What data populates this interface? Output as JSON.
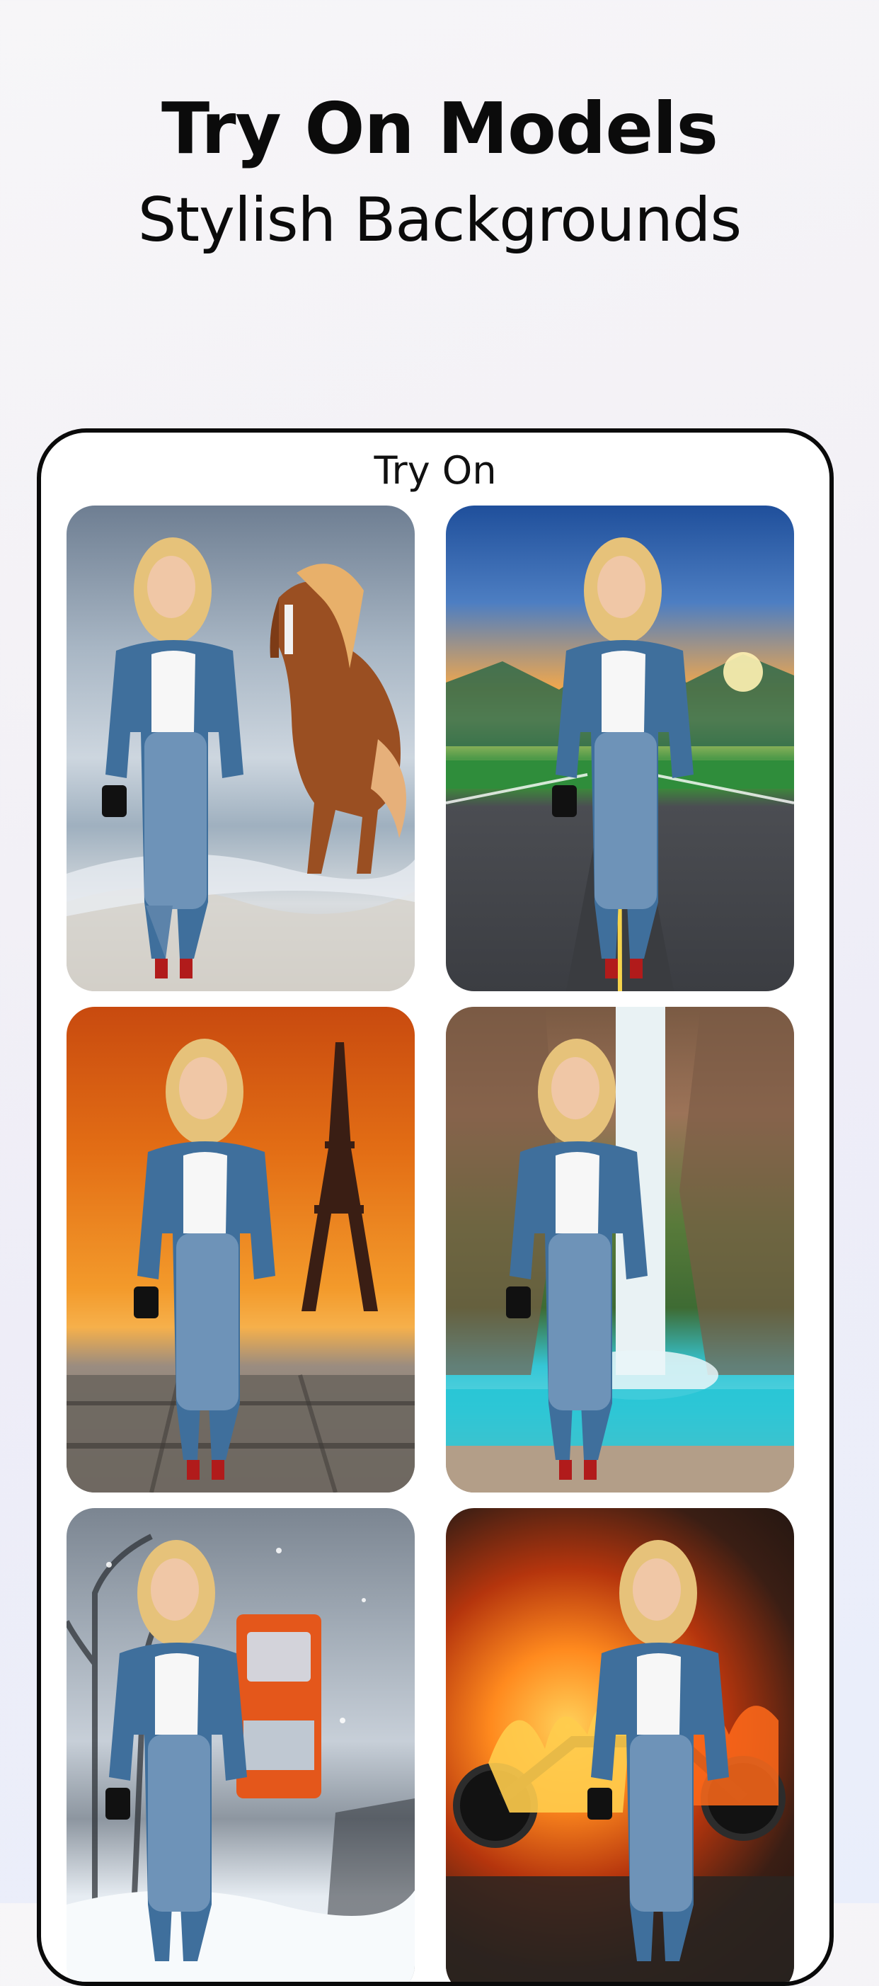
{
  "header": {
    "title": "Try On Models",
    "subtitle": "Stylish Backgrounds"
  },
  "screen": {
    "title": "Try On"
  },
  "gallery": {
    "items": [
      {
        "scene": "beach with horse"
      },
      {
        "scene": "mountain road at sunset"
      },
      {
        "scene": "eiffel tower at sunset"
      },
      {
        "scene": "waterfall lagoon"
      },
      {
        "scene": "snowy street with truck"
      },
      {
        "scene": "burning motorcycle"
      }
    ]
  },
  "colors": {
    "text": "#0b0b0b",
    "phone_border": "#0a0a0a",
    "phone_bg": "#ffffff",
    "page_bg_start": "#f7f6f8",
    "page_bg_end": "#e9eefb"
  }
}
